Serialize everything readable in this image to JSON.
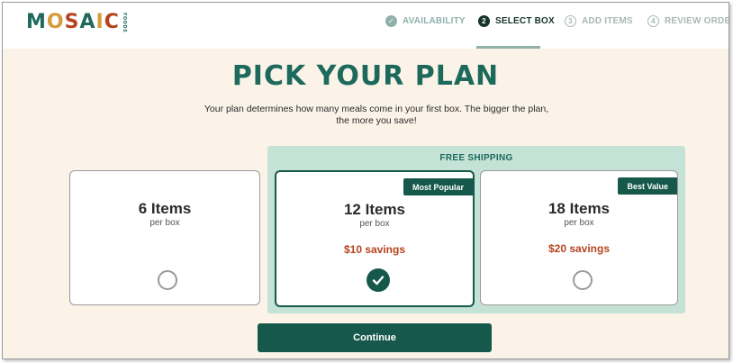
{
  "brand": {
    "logo_letters": [
      {
        "char": "M",
        "color": "#1d6a5c"
      },
      {
        "char": "O",
        "color": "#d69b3a"
      },
      {
        "char": "S",
        "color": "#b5431e"
      },
      {
        "char": "A",
        "color": "#1d6a5c"
      },
      {
        "char": "I",
        "color": "#d69b3a"
      },
      {
        "char": "C",
        "color": "#b5431e"
      }
    ],
    "logo_suffix": "FOODS"
  },
  "steps": [
    {
      "label": "AVAILABILITY",
      "badge": "✓",
      "state": "done"
    },
    {
      "label": "SELECT BOX",
      "badge": "2",
      "state": "active"
    },
    {
      "label": "ADD ITEMS",
      "badge": "3",
      "state": "todo"
    },
    {
      "label": "REVIEW ORDER",
      "badge": "4",
      "state": "todo"
    }
  ],
  "page": {
    "title": "PICK YOUR PLAN",
    "subtitle": "Your plan determines how many meals come in your first box. The bigger the plan, the more you save!",
    "shipping_label": "FREE SHIPPING",
    "continue_label": "Continue"
  },
  "plans": [
    {
      "title": "6 Items",
      "subtitle": "per box",
      "savings": "",
      "badge": "",
      "selected": false
    },
    {
      "title": "12 Items",
      "subtitle": "per box",
      "savings": "$10 savings",
      "badge": "Most Popular",
      "selected": true
    },
    {
      "title": "18 Items",
      "subtitle": "per box",
      "savings": "$20 savings",
      "badge": "Best Value",
      "selected": false
    }
  ],
  "colors": {
    "primary": "#16594c",
    "accent_green": "#1d6a5c",
    "savings": "#b5431e",
    "background": "#fbf3e8",
    "shipping_panel": "#c5e2d6"
  }
}
